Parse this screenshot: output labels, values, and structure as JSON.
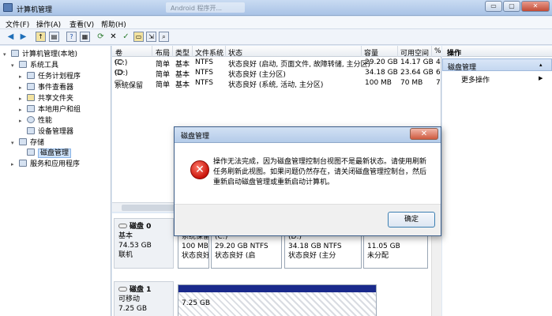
{
  "window": {
    "title": "计算机管理",
    "ghost_title": "Android 程序开...",
    "min_glyph": "▭",
    "max_glyph": "▢",
    "close_glyph": "✕"
  },
  "menu": [
    "文件(F)",
    "操作(A)",
    "查看(V)",
    "帮助(H)"
  ],
  "toolbar_icons": [
    "back-arrow-icon",
    "forward-arrow-icon",
    "up-folder-icon",
    "console-tree-icon",
    "help-icon",
    "properties-icon",
    "refresh-icon",
    "delete-icon",
    "check-icon",
    "open-icon",
    "export-icon",
    "zoom-icon"
  ],
  "tree": {
    "root": "计算机管理(本地)",
    "system_tools": "系统工具",
    "task_scheduler": "任务计划程序",
    "event_viewer": "事件查看器",
    "shared_folders": "共享文件夹",
    "local_users": "本地用户和组",
    "performance": "性能",
    "device_manager": "设备管理器",
    "storage": "存储",
    "disk_management": "磁盘管理",
    "services": "服务和应用程序"
  },
  "volumes": {
    "headers": [
      "卷",
      "布局",
      "类型",
      "文件系统",
      "状态",
      "容量",
      "可用空间",
      "%"
    ],
    "rows": [
      {
        "vol": "(C:)",
        "layout": "简单",
        "type": "基本",
        "fs": "NTFS",
        "status": "状态良好 (启动, 页面文件, 故障转储, 主分区)",
        "cap": "29.20 GB",
        "free": "14.17 GB",
        "pct": "4"
      },
      {
        "vol": "(D:)",
        "layout": "简单",
        "type": "基本",
        "fs": "NTFS",
        "status": "状态良好 (主分区)",
        "cap": "34.18 GB",
        "free": "23.64 GB",
        "pct": "6"
      },
      {
        "vol": "系统保留",
        "layout": "简单",
        "type": "基本",
        "fs": "NTFS",
        "status": "状态良好 (系统, 活动, 主分区)",
        "cap": "100 MB",
        "free": "70 MB",
        "pct": "7"
      }
    ]
  },
  "disks": {
    "disk0": {
      "name": "磁盘 0",
      "kind": "基本",
      "size": "74.53 GB",
      "state": "联机"
    },
    "disk0_parts": [
      {
        "title": "系统保留",
        "size": "100 MB",
        "status": "状态良好"
      },
      {
        "title": "(C:)",
        "size": "29.20 GB NTFS",
        "status": "状态良好 (启"
      },
      {
        "title": "(D:)",
        "size": "34.18 GB NTFS",
        "status": "状态良好 (主分"
      },
      {
        "title": "",
        "size": "11.05 GB",
        "status": "未分配"
      }
    ],
    "disk1": {
      "name": "磁盘 1",
      "kind": "可移动",
      "size": "7.25 GB"
    },
    "disk1_part": {
      "size": "7.25 GB"
    }
  },
  "actions": {
    "header": "操作",
    "group": "磁盘管理",
    "more": "更多操作"
  },
  "dialog": {
    "title": "磁盘管理",
    "message": "操作无法完成，因为磁盘管理控制台视图不是最新状态。请使用刷新任务刷新此视图。如果问题仍然存在，请关闭磁盘管理控制台，然后重新启动磁盘管理或重新启动计算机。",
    "ok": "确定",
    "error_glyph": "✕"
  }
}
